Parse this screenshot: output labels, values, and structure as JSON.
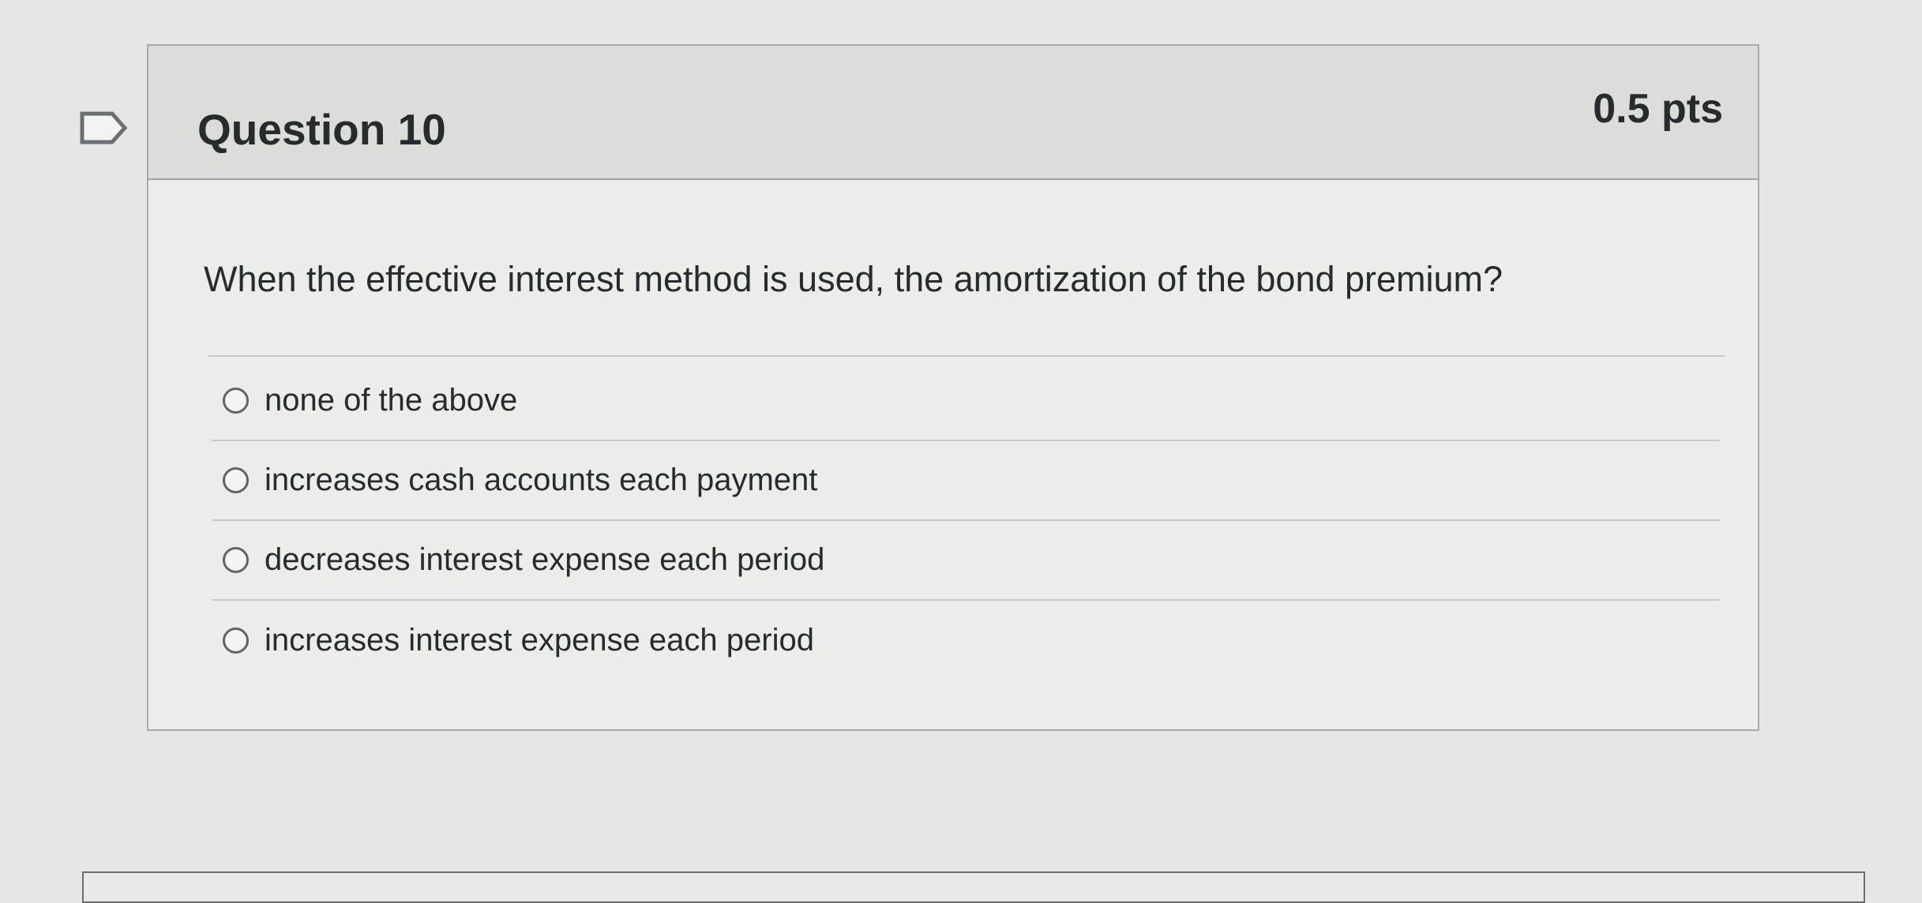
{
  "question": {
    "title": "Question 10",
    "points": "0.5 pts",
    "flag_icon": "flag-icon",
    "prompt": "When the effective interest method is used, the amortization of the bond premium?",
    "answers": [
      {
        "label": "none of the above",
        "selected": false
      },
      {
        "label": "increases cash accounts each payment",
        "selected": false
      },
      {
        "label": "decreases interest expense each period",
        "selected": false
      },
      {
        "label": "increases interest expense each period",
        "selected": false
      }
    ]
  },
  "colors": {
    "page_background": "#e6e6e4",
    "card_header": "#dcdcda",
    "card_body": "#ececea",
    "text": "#262b2e",
    "border": "#a9aaa8"
  }
}
